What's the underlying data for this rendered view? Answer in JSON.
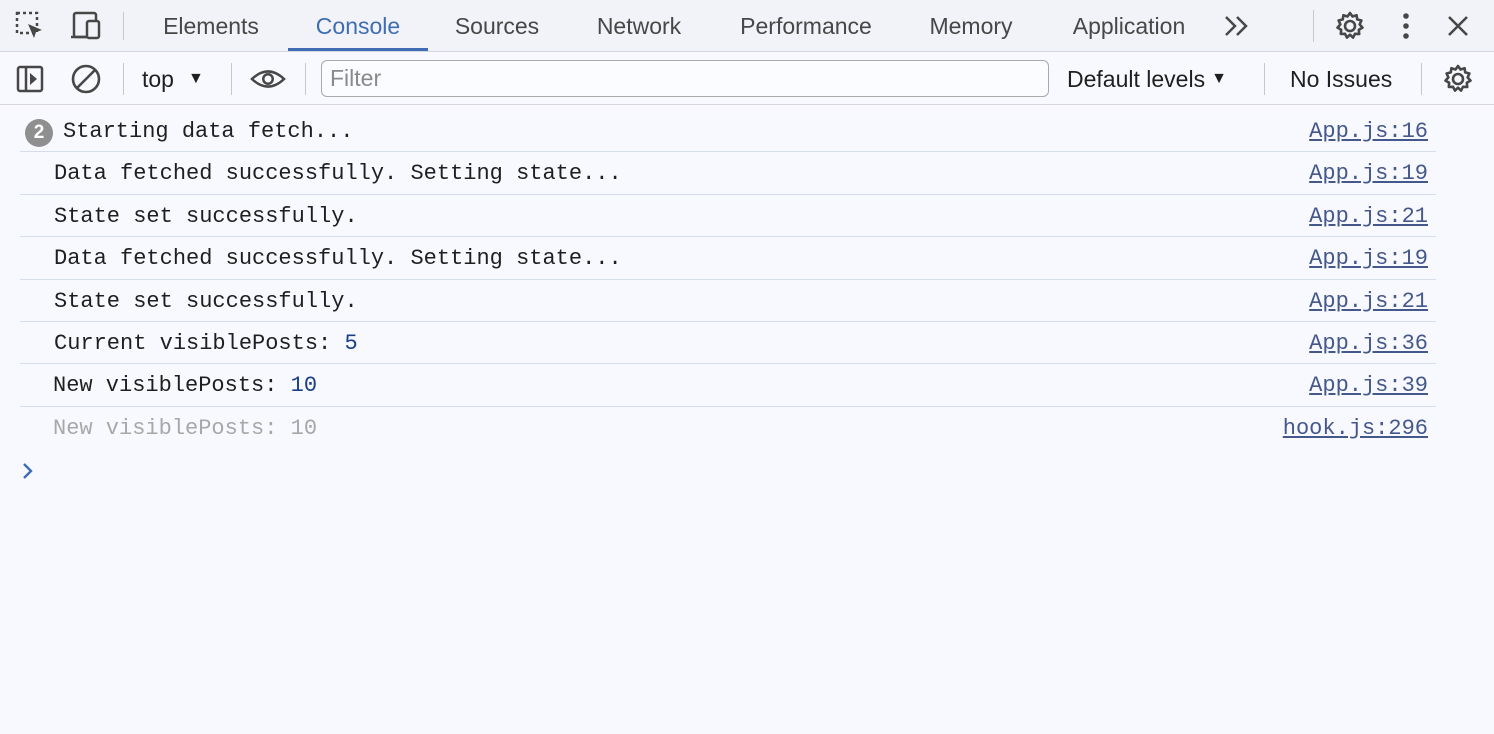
{
  "tabs": [
    {
      "label": "Elements"
    },
    {
      "label": "Console"
    },
    {
      "label": "Sources"
    },
    {
      "label": "Network"
    },
    {
      "label": "Performance"
    },
    {
      "label": "Memory"
    },
    {
      "label": "Application"
    }
  ],
  "toolbar": {
    "context": "top",
    "filter_placeholder": "Filter",
    "levels": "Default levels",
    "issues": "No Issues"
  },
  "messages": [
    {
      "badge": "2",
      "text": "Starting data fetch...",
      "value": "",
      "source": "App.js:16"
    },
    {
      "text": "Data fetched successfully. Setting state...",
      "value": "",
      "source": "App.js:19"
    },
    {
      "text": "State set successfully.",
      "value": "",
      "source": "App.js:21"
    },
    {
      "text": "Data fetched successfully. Setting state...",
      "value": "",
      "source": "App.js:19"
    },
    {
      "text": "State set successfully.",
      "value": "",
      "source": "App.js:21"
    },
    {
      "text": "Current visiblePosts: ",
      "value": "5",
      "source": "App.js:36"
    },
    {
      "text": "New visiblePosts: ",
      "value": "10",
      "source": "App.js:39"
    },
    {
      "text": "New visiblePosts: ",
      "value": "10",
      "source": "hook.js:296"
    }
  ],
  "colors": {
    "accent": "#3f6db3",
    "badge": "#8f8f8f",
    "link": "#45588c"
  }
}
